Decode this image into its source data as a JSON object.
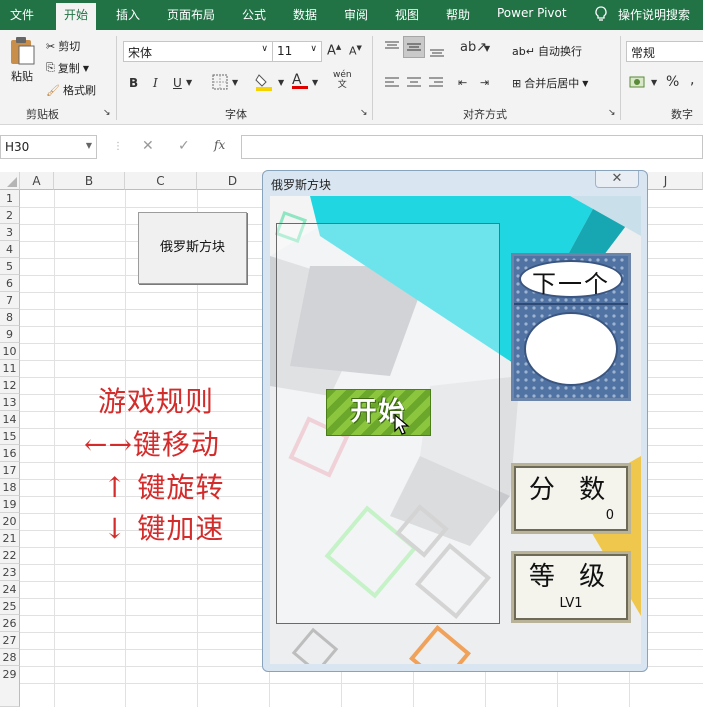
{
  "menu": {
    "tabs": [
      "文件",
      "开始",
      "插入",
      "页面布局",
      "公式",
      "数据",
      "审阅",
      "视图",
      "帮助",
      "Power Pivot"
    ],
    "active_tab": "开始",
    "tell_me": "操作说明搜索"
  },
  "ribbon": {
    "clipboard": {
      "paste": "粘贴",
      "cut": "剪切",
      "copy": "复制",
      "format_painter": "格式刷",
      "group": "剪贴板"
    },
    "font": {
      "name": "宋体",
      "size": "11",
      "bold": "B",
      "italic": "I",
      "underline": "U",
      "group": "字体",
      "phonetic": "wén"
    },
    "alignment": {
      "wrap_text": "自动换行",
      "merge_center": "合并后居中",
      "group": "对齐方式"
    },
    "number": {
      "format": "常规",
      "percent": "%",
      "comma": ",",
      "group": "数字"
    }
  },
  "formula_bar": {
    "name_box": "H30",
    "fx": "fx",
    "formula": ""
  },
  "grid": {
    "columns": [
      "A",
      "B",
      "C",
      "D",
      "",
      "",
      "",
      "",
      "",
      "J"
    ],
    "rows": [
      "1",
      "2",
      "3",
      "4",
      "5",
      "6",
      "7",
      "8",
      "9",
      "10",
      "11",
      "12",
      "13",
      "14",
      "15",
      "16",
      "17",
      "18",
      "19",
      "20",
      "21",
      "22",
      "23",
      "24",
      "25",
      "26",
      "27",
      "28",
      "29"
    ]
  },
  "sheet_button": {
    "label": "俄罗斯方块"
  },
  "rules": {
    "title": "游戏规则",
    "line1": "←→键移动",
    "line2": "↑ 键旋转",
    "line3": "↓ 键加速"
  },
  "form": {
    "title": "俄罗斯方块",
    "close": "✕",
    "start": "开始",
    "next_label": "下一个",
    "score_label": "分 数",
    "score_value": "0",
    "level_label": "等 级",
    "level_value": "LV1"
  },
  "colors": {
    "excel_green": "#217346",
    "rule_red": "#d42b2b"
  }
}
